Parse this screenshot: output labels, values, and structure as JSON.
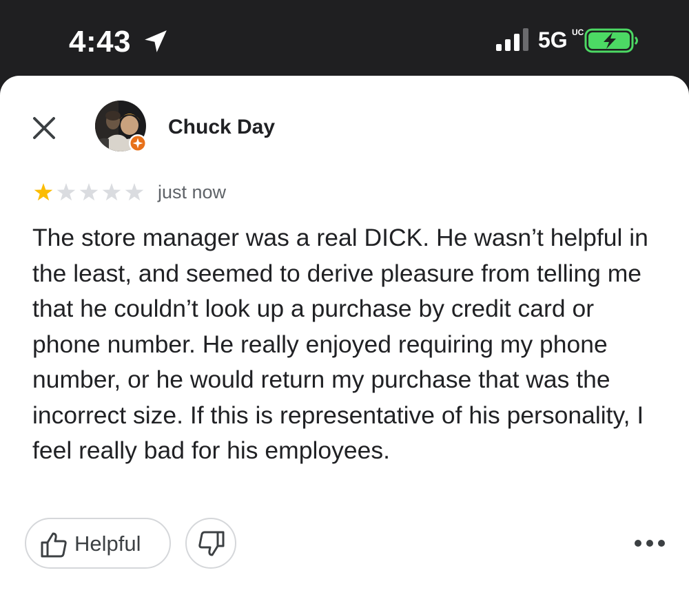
{
  "status_bar": {
    "time": "4:43",
    "network": "5G",
    "network_suffix": "UC",
    "location_icon": "location-arrow-icon",
    "signal_icon": "cellular-signal-icon",
    "battery_icon": "battery-charging-icon"
  },
  "review": {
    "author": "Chuck Day",
    "rating": 1,
    "max_rating": 5,
    "time": "just now",
    "text": "The store manager was a real DICK. He wasn’t helpful in the least, and seemed to derive pleasure from telling me that he couldn’t look up a purchase by credit card or phone number. He really enjoyed requiring my phone number, or he would return my purchase that was the incorrect size. If this is representative of his personality, I feel really bad for his employees."
  },
  "actions": {
    "helpful_label": "Helpful",
    "helpful_icon": "thumbs-up-icon",
    "not_helpful_icon": "thumbs-down-icon",
    "more_icon": "more-horizontal-icon",
    "close_icon": "close-icon"
  },
  "colors": {
    "status_bar_bg": "#1f1f21",
    "star_filled": "#fbbc04",
    "star_empty": "#dadce0",
    "battery_green": "#4cd964",
    "local_guide_badge": "#e8711a",
    "text_primary": "#202124",
    "text_secondary": "#5f6368"
  }
}
